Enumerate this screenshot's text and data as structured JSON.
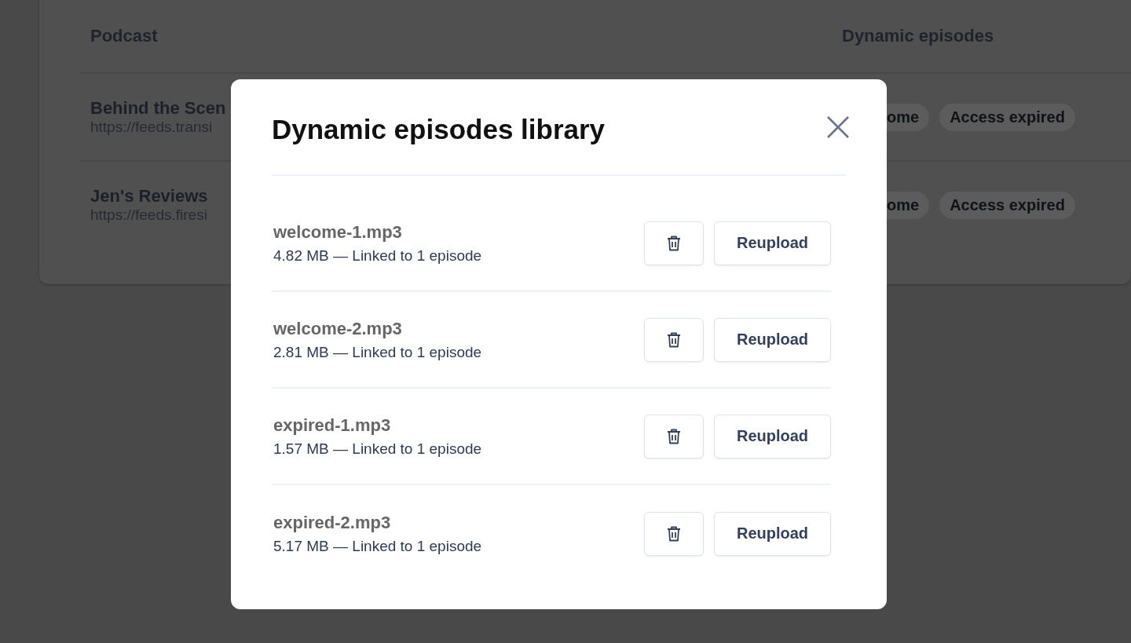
{
  "table": {
    "columns": [
      "Podcast",
      "Dynamic episodes"
    ],
    "rows": [
      {
        "title": "Behind the Scen",
        "url": "https://feeds.transi",
        "tags": [
          "ome",
          "Access expired"
        ]
      },
      {
        "title": "Jen's Reviews",
        "url": "https://feeds.firesi",
        "tags": [
          "ome",
          "Access expired"
        ]
      }
    ]
  },
  "modal": {
    "title": "Dynamic episodes library",
    "files": [
      {
        "name": "welcome-1.mp3",
        "meta": "4.82 MB — Linked to 1 episode",
        "button": "Reupload"
      },
      {
        "name": "welcome-2.mp3",
        "meta": "2.81 MB — Linked to 1 episode",
        "button": "Reupload"
      },
      {
        "name": "expired-1.mp3",
        "meta": "1.57 MB — Linked to 1 episode",
        "button": "Reupload"
      },
      {
        "name": "expired-2.mp3",
        "meta": "5.17 MB — Linked to 1 episode",
        "button": "Reupload"
      }
    ]
  }
}
